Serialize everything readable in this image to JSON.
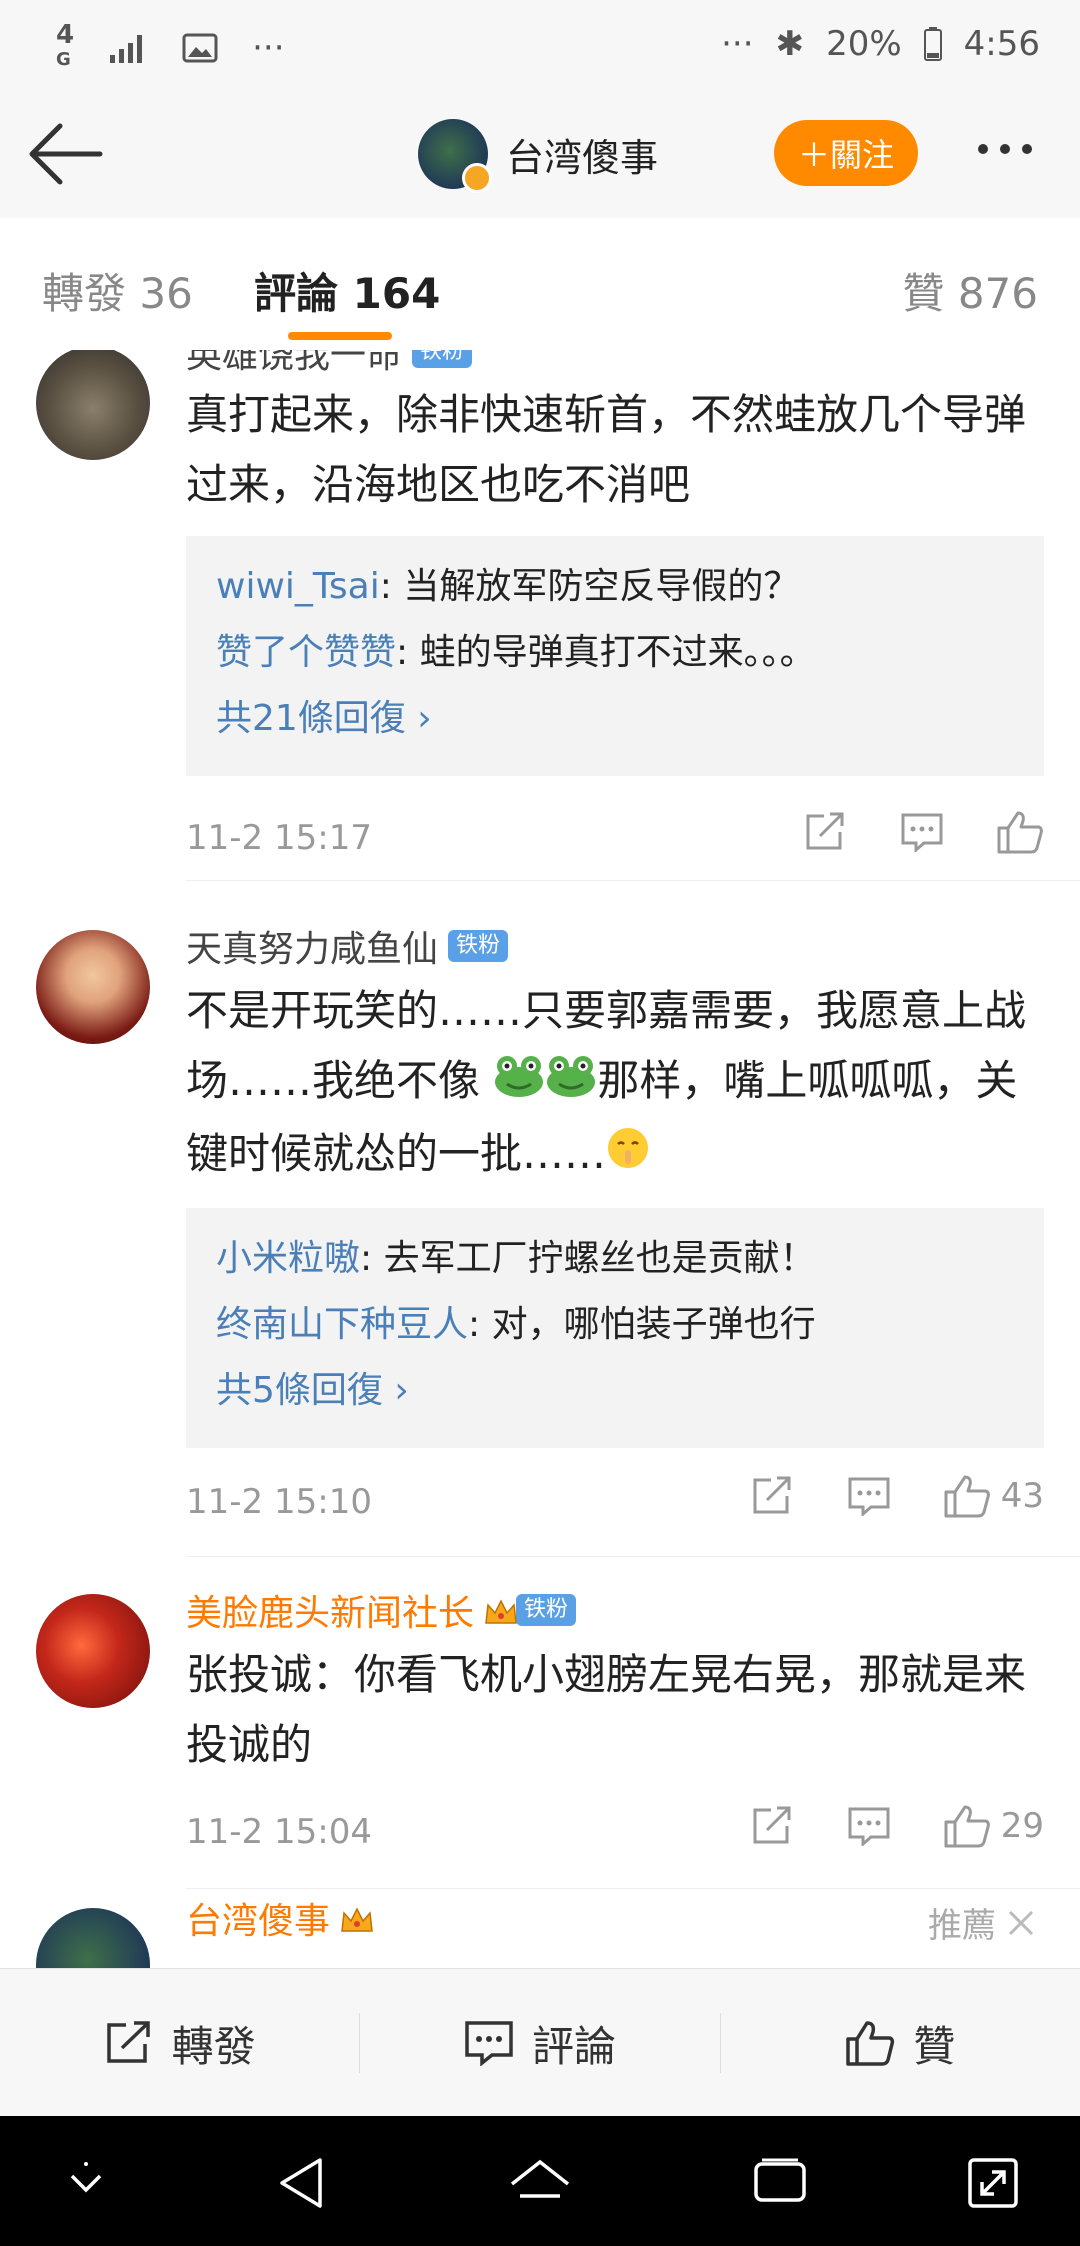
{
  "status": {
    "left_icons": [
      "4g-icon",
      "signal-icon",
      "image-icon",
      "more-dots-icon"
    ],
    "battery": "20%",
    "time": "4:56"
  },
  "header": {
    "title": "台湾傻事",
    "follow_label": "＋關注"
  },
  "tabs": [
    {
      "label": "轉發 36"
    },
    {
      "label": "評論 164"
    },
    {
      "label": "贊 876"
    }
  ],
  "comments": [
    {
      "name": "英雄饶我一命",
      "badge": "铁粉",
      "text": "真打起来，除非快速斩首，不然蛙放几个导弹过来，沿海地区也吃不消吧",
      "replies": [
        {
          "name": "wiwi_Tsai",
          "text": ": 当解放军防空反导假的？"
        },
        {
          "name": "赞了个赞赞",
          "text": ": 蛙的导弹真打不过来。。。"
        }
      ],
      "more": "共21條回復 ›",
      "time": "11-2 15:17",
      "likes": ""
    },
    {
      "name": "天真努力咸鱼仙",
      "badge": "铁粉",
      "text_a": "不是开玩笑的……只要郭嘉需要，我愿意上战场……我绝不像",
      "text_b": "那样，嘴上呱呱呱，关键时候就怂的一批……",
      "replies": [
        {
          "name": "小米粒嗷",
          "text": ": 去军工厂拧螺丝也是贡献！"
        },
        {
          "name": "终南山下种豆人",
          "text": ": 对，哪怕装子弹也行"
        }
      ],
      "more": "共5條回復 ›",
      "time": "11-2 15:10",
      "likes": "43"
    },
    {
      "name": "美脸鹿头新闻社长",
      "badge": "铁粉",
      "text": "张投诚：你看飞机小翅膀左晃右晃，那就是来投诚的",
      "time": "11-2 15:04",
      "likes": "29"
    },
    {
      "name": "台湾傻事",
      "recommend": "推薦"
    }
  ],
  "bottom_bar": {
    "repost": "轉發",
    "comment": "評論",
    "like": "贊"
  }
}
